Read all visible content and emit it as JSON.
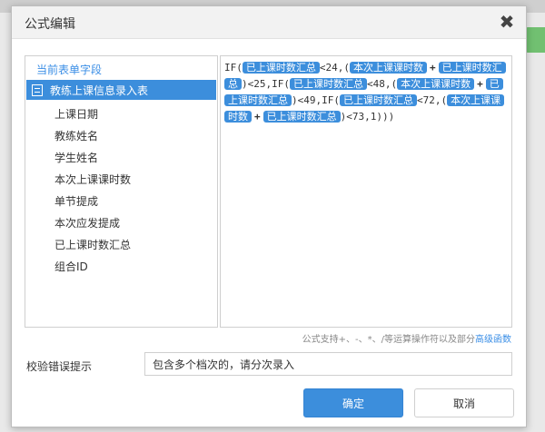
{
  "dialog": {
    "title": "公式编辑",
    "close_glyph": "✖"
  },
  "fields_panel": {
    "heading": "当前表单字段",
    "table_name": "教练上课信息录入表",
    "fields": [
      "上课日期",
      "教练姓名",
      "学生姓名",
      "本次上课课时数",
      "单节提成",
      "本次应发提成",
      "已上课时数汇总",
      "组合ID"
    ]
  },
  "formula": {
    "tokens": [
      {
        "type": "text",
        "value": "IF("
      },
      {
        "type": "field",
        "value": "已上课时数汇总"
      },
      {
        "type": "text",
        "value": "<24,("
      },
      {
        "type": "field",
        "value": "本次上课课时数"
      },
      {
        "type": "plus",
        "value": "+"
      },
      {
        "type": "field",
        "value": "已上课时数汇总"
      },
      {
        "type": "text",
        "value": ")<25,IF("
      },
      {
        "type": "field",
        "value": "已上课时数汇总"
      },
      {
        "type": "text",
        "value": "<48,("
      },
      {
        "type": "field",
        "value": "本次上课课时数"
      },
      {
        "type": "plus",
        "value": "+"
      },
      {
        "type": "field",
        "value": "已上课时数汇总"
      },
      {
        "type": "text",
        "value": ")<49,IF("
      },
      {
        "type": "field",
        "value": "已上课时数汇总"
      },
      {
        "type": "text",
        "value": "<72,("
      },
      {
        "type": "field",
        "value": "本次上课课时数"
      },
      {
        "type": "plus",
        "value": "+"
      },
      {
        "type": "field",
        "value": "已上课时数汇总"
      },
      {
        "type": "text",
        "value": ")<73,1)))"
      }
    ]
  },
  "hint": {
    "text": "公式支持+、-、*、/等运算操作符以及部分",
    "link": "高级函数"
  },
  "validation": {
    "label": "校验错误提示",
    "value": "包含多个档次的，请分次录入"
  },
  "buttons": {
    "ok": "确定",
    "cancel": "取消"
  },
  "colors": {
    "accent": "#3c8edc",
    "link": "#3a8ee6"
  }
}
